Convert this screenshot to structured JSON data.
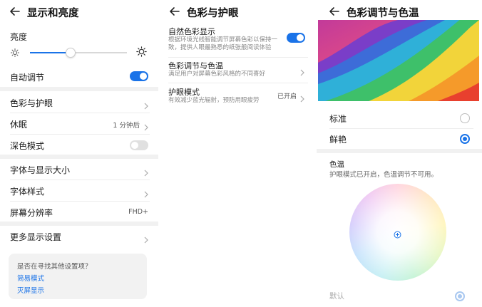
{
  "panel1": {
    "title": "显示和亮度",
    "brightness_label": "亮度",
    "brightness_level": 0.42,
    "auto_adjust_label": "自动调节",
    "auto_adjust_on": true,
    "items": [
      {
        "label": "色彩与护眼",
        "value": ""
      },
      {
        "label": "休眠",
        "value": "1 分钟后"
      },
      {
        "label": "深色模式",
        "value": ""
      },
      {
        "label": "字体与显示大小",
        "value": ""
      },
      {
        "label": "字体样式",
        "value": ""
      },
      {
        "label": "屏幕分辨率",
        "value": "FHD+"
      },
      {
        "label": "更多显示设置",
        "value": ""
      }
    ],
    "dark_mode_on": false,
    "hint": {
      "question": "是否在寻找其他设置项？",
      "link1": "简易模式",
      "link2": "灭屏显示"
    }
  },
  "panel2": {
    "title": "色彩与护眼",
    "natural_color": {
      "label": "自然色彩显示",
      "desc_line1": "根据环境光线智能调节屏幕色彩以保持一",
      "desc_line2": "致，提供人眼最熟悉的纸张般阅读体验",
      "on": true
    },
    "color_temp": {
      "label": "色彩调节与色温",
      "desc": "满足用户对屏幕色彩风格的不同喜好"
    },
    "eye_care": {
      "label": "护眼模式",
      "desc": "有效减少蓝光辐射，预防用眼疲劳",
      "value": "已开启"
    }
  },
  "panel3": {
    "title": "色彩调节与色温",
    "modes": [
      {
        "label": "标准",
        "selected": false
      },
      {
        "label": "鲜艳",
        "selected": true
      }
    ],
    "temp_label": "色温",
    "temp_note": "护眼模式已开启，色温调节不可用。",
    "default_label": "默认"
  },
  "colors": {
    "accent": "#1a73e8",
    "divider": "#f1f1f1",
    "hint_bg": "#f2f2f2"
  }
}
